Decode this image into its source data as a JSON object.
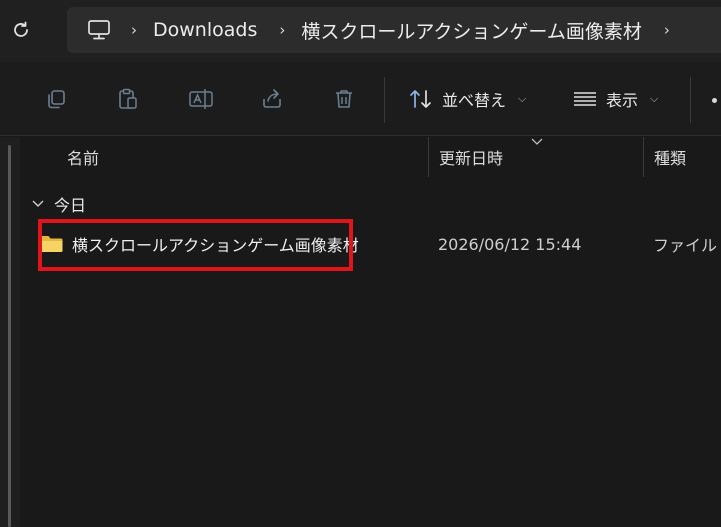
{
  "address_bar": {
    "breadcrumbs": [
      "Downloads",
      "横スクロールアクションゲーム画像素材"
    ],
    "separator_glyph": "›"
  },
  "command_bar": {
    "sort_label": "並べ替え",
    "view_label": "表示"
  },
  "columns": {
    "name": "名前",
    "date": "更新日時",
    "type": "種類"
  },
  "group": {
    "label": "今日"
  },
  "files": [
    {
      "name": "横スクロールアクションゲーム画像素材",
      "date": "2026/06/12 15:44",
      "type": "ファイル"
    }
  ],
  "colors": {
    "highlight": "#e0141b",
    "folder": "#f2c94c",
    "background": "#191919"
  },
  "icons": [
    "refresh-icon",
    "computer-icon",
    "copy-icon",
    "paste-icon",
    "rename-icon",
    "share-icon",
    "delete-icon",
    "sort-icon",
    "view-icon",
    "folder-icon"
  ]
}
